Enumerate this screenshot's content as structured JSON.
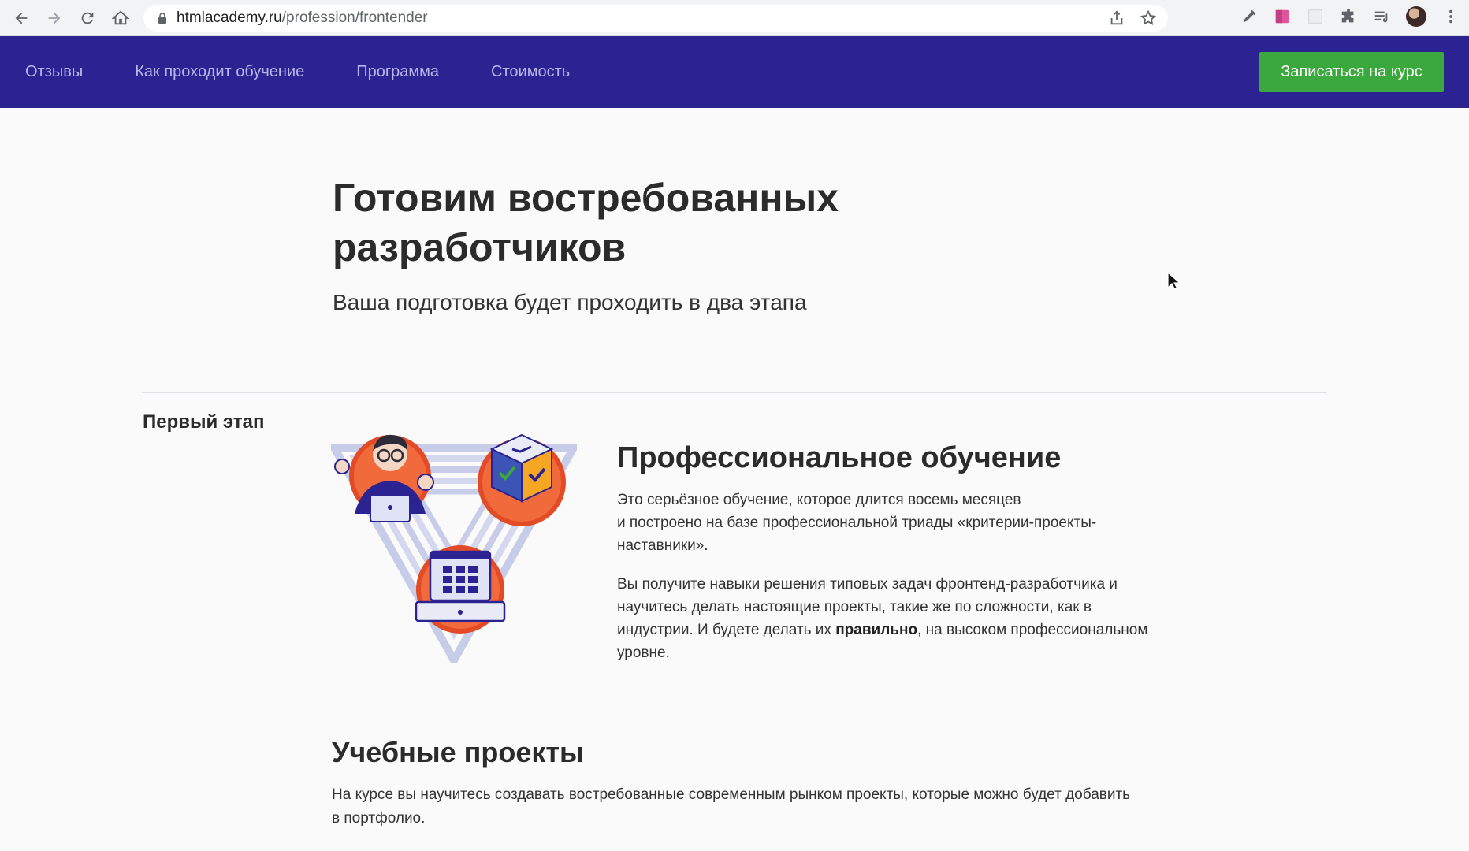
{
  "browser": {
    "url_host": "htmlacademy.ru",
    "url_path": "/profession/frontender",
    "icons": [
      "back-icon",
      "forward-icon",
      "reload-icon",
      "home-icon",
      "lock-icon",
      "share-icon",
      "star-icon",
      "eyedropper-icon",
      "extension-icon",
      "puzzle-icon",
      "reading-list-icon",
      "avatar",
      "kebab-menu-icon"
    ]
  },
  "header": {
    "nav": [
      {
        "label": "Отзывы"
      },
      {
        "label": "Как проходит обучение"
      },
      {
        "label": "Программа"
      },
      {
        "label": "Стоимость"
      }
    ],
    "cta_label": "Записаться на курс",
    "colors": {
      "background": "#2a2391",
      "cta": "#3aa83c",
      "link": "#b9b6ea"
    }
  },
  "hero": {
    "title_line1": "Готовим востребованных",
    "title_line2": "разработчиков",
    "subtitle": "Ваша подготовка будет проходить в два этапа"
  },
  "stage": {
    "label": "Первый этап",
    "title": "Профессиональное обучение",
    "p1_line1": "Это серьёзное обучение, которое длится восемь месяцев",
    "p1_line2": "и построено на базе профессиональной триады «критерии-проекты-",
    "p1_line3": "наставники».",
    "p2_part1": "Вы получите навыки решения типовых задач фронтенд-разработчика и научитесь делать настоящие проекты, такие же по сложности, как в индустрии. И будете делать их ",
    "p2_bold": "правильно",
    "p2_part2": ", на высоком профессиональном уровне."
  },
  "projects": {
    "title": "Учебные проекты",
    "text": "На курсе вы научитесь создавать востребованные современным рынком проекты, которые можно будет добавить в портфолио."
  }
}
